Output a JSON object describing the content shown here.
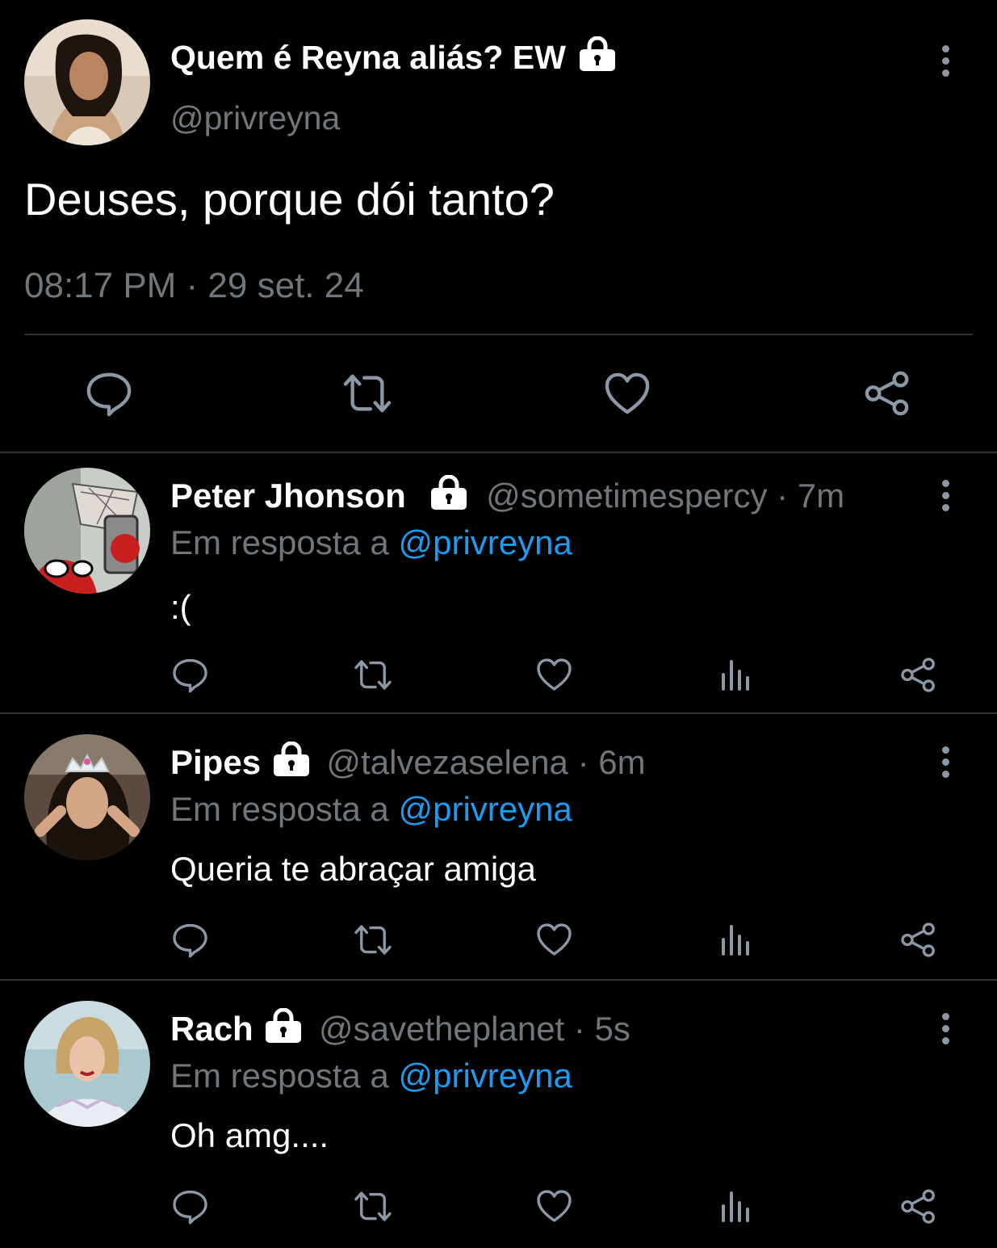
{
  "main_tweet": {
    "display_name": "Quem é Reyna aliás? EW",
    "handle": "@privreyna",
    "text": "Deuses, porque dói tanto?",
    "timestamp": "08:17 PM · 29 set. 24",
    "icons": [
      "reply-icon",
      "retweet-icon",
      "like-icon",
      "share-icon"
    ]
  },
  "replies": [
    {
      "display_name": "Peter Jhonson",
      "handle": "@sometimespercy",
      "time": "· 7m",
      "reply_prefix": "Em resposta a",
      "reply_to": "@privreyna",
      "text": ":("
    },
    {
      "display_name": "Pipes",
      "handle": "@talvezaselena",
      "time": "· 6m",
      "reply_prefix": "Em resposta a",
      "reply_to": "@privreyna",
      "text": "Queria te abraçar amiga"
    },
    {
      "display_name": "Rach",
      "handle": "@savetheplanet",
      "time": "· 5s",
      "reply_prefix": "Em resposta a",
      "reply_to": "@privreyna",
      "text": "Oh amg...."
    }
  ],
  "colors": {
    "background": "#000000",
    "text": "#e7e9ea",
    "secondary": "#71767b",
    "accent": "#1d9bf0",
    "icon": "#8b98a5",
    "divider": "#2f3336"
  }
}
